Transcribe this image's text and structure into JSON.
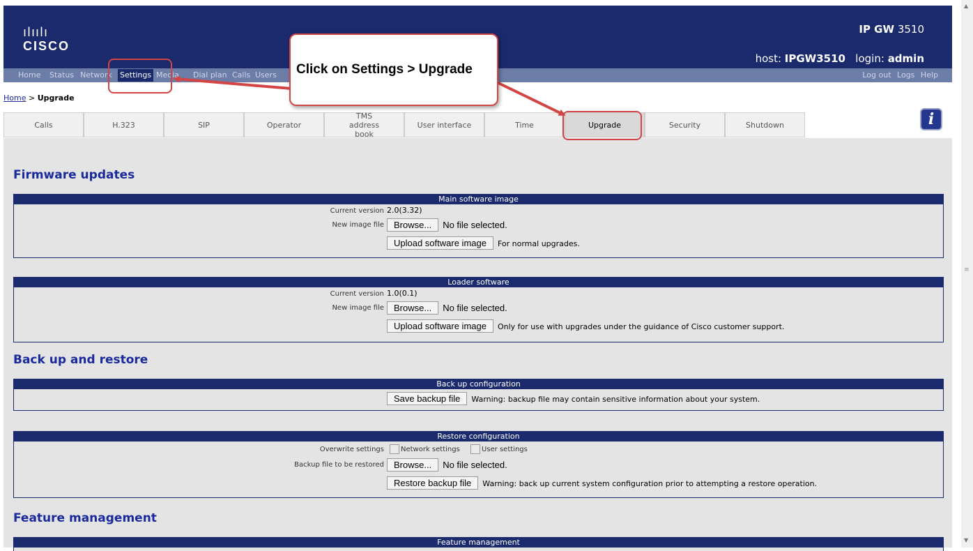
{
  "product": {
    "prefix": "IP GW",
    "model": "3510"
  },
  "logo": {
    "bars": "ılıılı",
    "text": "CISCO"
  },
  "host": {
    "host_label": "host:",
    "host_value": "IPGW3510",
    "login_label": "login:",
    "login_value": "admin"
  },
  "nav": {
    "items": [
      "Home",
      "Status",
      "Network",
      "Settings",
      "Media",
      "Dial plan",
      "Calls",
      "Users"
    ],
    "right": [
      "Log out",
      "Logs",
      "Help"
    ]
  },
  "breadcrumb": {
    "home": "Home",
    "sep": " > ",
    "current": "Upgrade"
  },
  "tabs": [
    "Calls",
    "H.323",
    "SIP",
    "Operator",
    "TMS address book",
    "User interface",
    "Time",
    "Upgrade",
    "Security",
    "Shutdown"
  ],
  "info_icon": "i",
  "callout": "Click on Settings > Upgrade",
  "sections": {
    "firmware": "Firmware updates",
    "backup": "Back up and restore",
    "feature": "Feature management"
  },
  "main_image": {
    "header": "Main software image",
    "current_label": "Current version",
    "current_value": "2.0(3.32)",
    "file_label": "New image file",
    "browse": "Browse...",
    "nofile": "No file selected.",
    "upload": "Upload software image",
    "note": "For normal upgrades."
  },
  "loader": {
    "header": "Loader software",
    "current_label": "Current version",
    "current_value": "1.0(0.1)",
    "file_label": "New image file",
    "browse": "Browse...",
    "nofile": "No file selected.",
    "upload": "Upload software image",
    "note": "Only for use with upgrades under the guidance of Cisco customer support."
  },
  "backup_cfg": {
    "header": "Back up configuration",
    "save": "Save backup file",
    "note": "Warning: backup file may contain sensitive information about your system."
  },
  "restore_cfg": {
    "header": "Restore configuration",
    "overwrite_label": "Overwrite settings",
    "opt1": "Network settings",
    "opt2": "User settings",
    "file_label": "Backup file to be restored",
    "browse": "Browse...",
    "nofile": "No file selected.",
    "restore": "Restore backup file",
    "note": "Warning: back up current system configuration prior to attempting a restore operation."
  },
  "feature_mgmt": {
    "header": "Feature management"
  },
  "colors": {
    "banner": "#1a2a6c",
    "nav": "#6c7da7",
    "accent_red": "#d34545",
    "section_title": "#1a2a9c"
  }
}
